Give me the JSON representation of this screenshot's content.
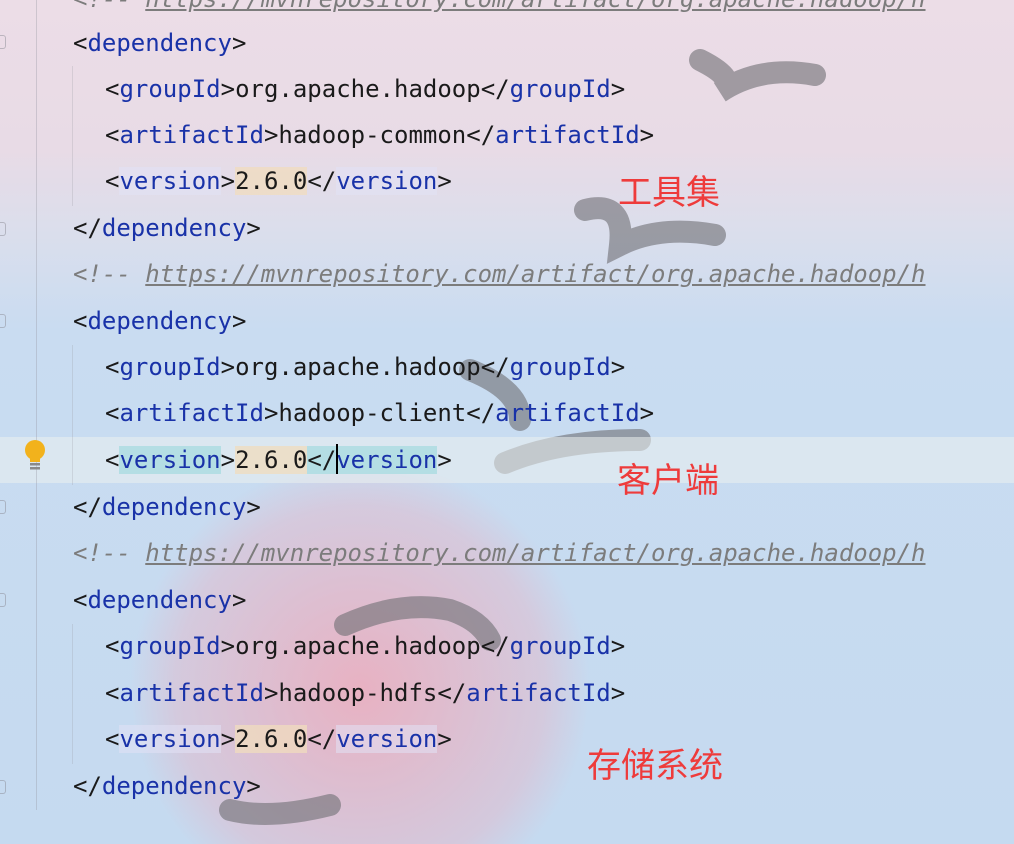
{
  "editor": {
    "top_comment": "<!-- https://mvnrepository.com/artifact/org.apache.hadoop/h",
    "comment_prefix": "<!-- ",
    "comment_url": "https://mvnrepository.com/artifact/org.apache.hadoop/h",
    "dependencies": [
      {
        "groupId": "org.apache.hadoop",
        "artifactId": "hadoop-common",
        "version": "2.6.0"
      },
      {
        "groupId": "org.apache.hadoop",
        "artifactId": "hadoop-client",
        "version": "2.6.0"
      },
      {
        "groupId": "org.apache.hadoop",
        "artifactId": "hadoop-hdfs",
        "version": "2.6.0"
      }
    ],
    "tags": {
      "dependency": "dependency",
      "groupId": "groupId",
      "artifactId": "artifactId",
      "version": "version"
    }
  },
  "annotations": {
    "common": "工具集",
    "client": "客户端",
    "hdfs": "存储系统"
  },
  "colors": {
    "tag": "#1932a8",
    "comment": "#7c7c7c",
    "annotation": "#ee3b3b",
    "version_highlight": "#f0dcbe"
  },
  "icons": [
    "lightbulb-icon",
    "fold-icon"
  ]
}
